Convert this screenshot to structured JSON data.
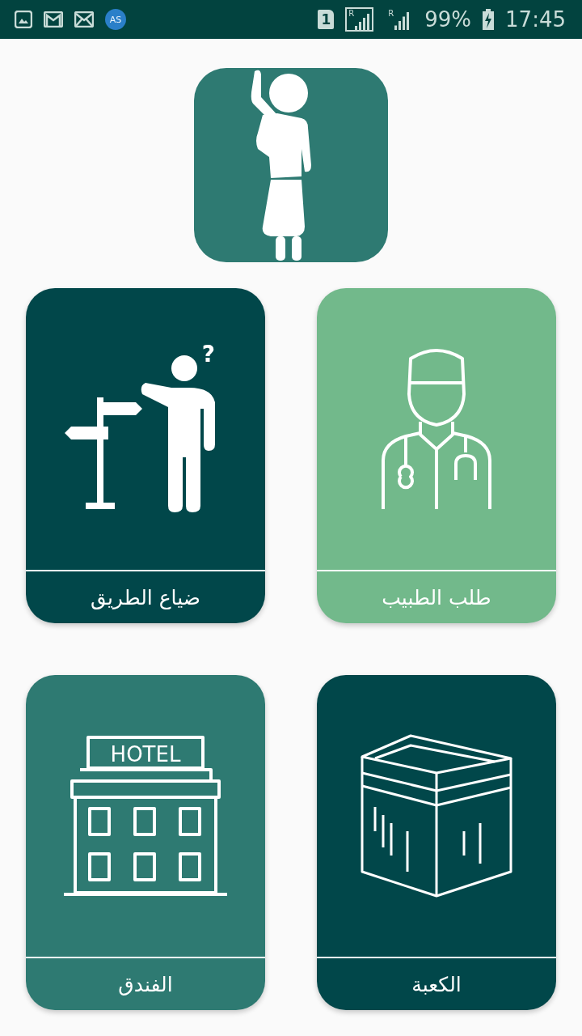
{
  "status_bar": {
    "notifications": [
      {
        "kind": "gallery"
      },
      {
        "kind": "gmail"
      },
      {
        "kind": "mail"
      },
      {
        "kind": "avatar",
        "text": "AS"
      }
    ],
    "sim": "1",
    "sim_signal": {
      "roaming": "R"
    },
    "mobile_signal": {
      "roaming": "R"
    },
    "battery": "99%",
    "charging": true,
    "time": "17:45"
  },
  "header_icon": {
    "kind": "pilgrim"
  },
  "cards": [
    {
      "label": "طلب الطبيب",
      "kind": "doctor",
      "color": "#72b98b"
    },
    {
      "label": "ضياع الطريق",
      "kind": "lost",
      "color": "#01474a",
      "icon_text": "?"
    },
    {
      "label": "الكعبة",
      "kind": "kaaba",
      "color": "#01474a"
    },
    {
      "label": "الفندق",
      "kind": "hotel",
      "color": "#2e7a72",
      "icon_text": "HOTEL"
    }
  ]
}
